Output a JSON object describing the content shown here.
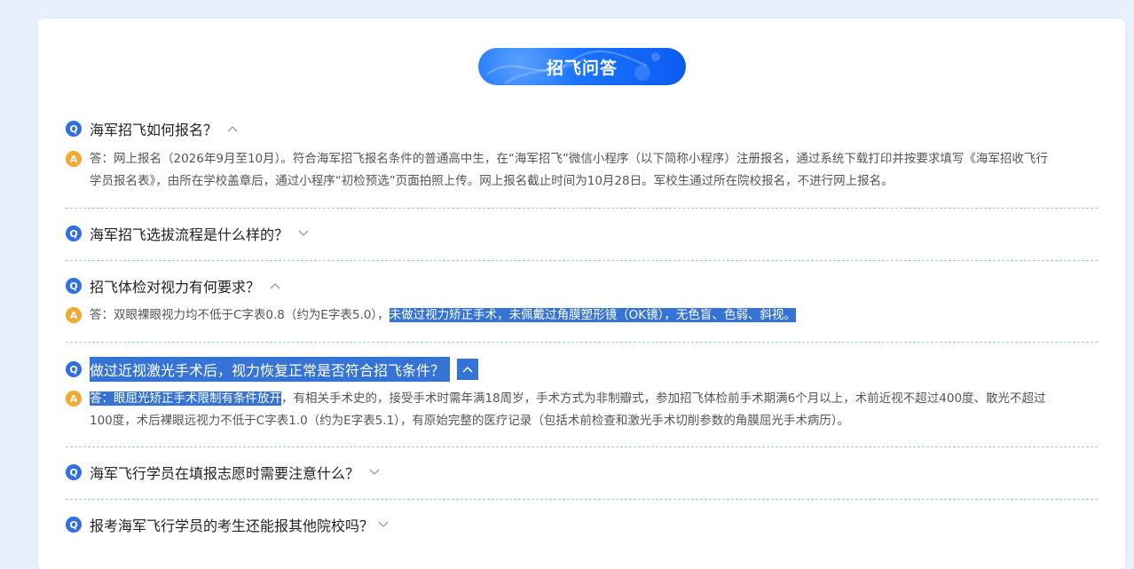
{
  "section_title": "招飞问答",
  "faq": [
    {
      "question": "海军招飞如何报名？",
      "expanded": true,
      "answer": "答：网上报名（2026年9月至10月）。符合海军招飞报名条件的普通高中生，在“海军招飞”微信小程序（以下简称小程序）注册报名，通过系统下载打印并按要求填写《海军招收飞行学员报名表》，由所在学校盖章后，通过小程序“初检预选”页面拍照上传。网上报名截止时间为10月28日。军校生通过所在院校报名，不进行网上报名。"
    },
    {
      "question": "海军招飞选拔流程是什么样的？",
      "expanded": false
    },
    {
      "question": "招飞体检对视力有何要求？",
      "expanded": true,
      "answer_part1": "答：双眼裸眼视力均不低于C字表0.8（约为E字表5.0），",
      "answer_part2": "未做过视力矫正手术，未佩戴过角膜塑形镜（OK镜），无色盲、色弱、斜视。"
    },
    {
      "question": "做过近视激光手术后，视力恢复正常是否符合招飞条件？",
      "expanded": true,
      "answer_part1": "答：眼屈光矫正手术限制有条件放开",
      "answer_part2": "，有相关手术史的，接受手术时需年满18周岁，手术方式为非制瓣式，参加招飞体检前手术期满6个月以上，术前近视不超过400度、散光不超过100度，术后裸眼远视力不低于C字表1.0（约为E字表5.1），有原始完整的医疗记录（包括术前检查和激光手术切削参数的角膜屈光手术病历）。"
    },
    {
      "question": "海军飞行学员在填报志愿时需要注意什么？",
      "expanded": false
    },
    {
      "question": "报考海军飞行学员的考生还能报其他院校吗？",
      "expanded": false
    }
  ],
  "badges": {
    "q": "Q",
    "a": "A"
  },
  "colors": {
    "accent": "#2f6fe0",
    "answer_badge": "#f4a732",
    "selection": "#3574d6"
  },
  "icons": {
    "expanded": "chevron-up-icon",
    "collapsed": "chevron-down-icon"
  }
}
